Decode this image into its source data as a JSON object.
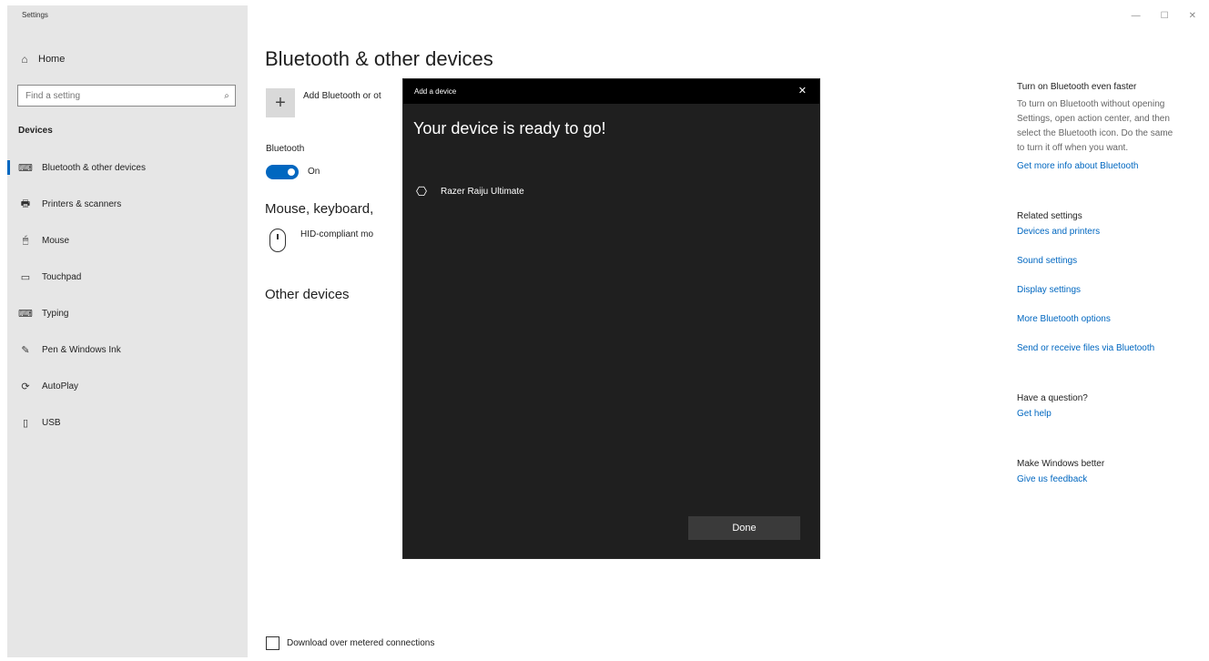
{
  "app": {
    "title": "Settings"
  },
  "window_controls": {
    "minimize": "—",
    "maximize": "☐",
    "close": "✕"
  },
  "sidebar": {
    "home_label": "Home",
    "search": {
      "placeholder": "Find a setting"
    },
    "section_label": "Devices",
    "items": [
      {
        "label": "Bluetooth & other devices",
        "icon": "bluetooth-device-icon",
        "glyph": "⌨"
      },
      {
        "label": "Printers & scanners",
        "icon": "printer-icon",
        "glyph": "🖶"
      },
      {
        "label": "Mouse",
        "icon": "mouse-icon",
        "glyph": "🖱"
      },
      {
        "label": "Touchpad",
        "icon": "touchpad-icon",
        "glyph": "▭"
      },
      {
        "label": "Typing",
        "icon": "keyboard-icon",
        "glyph": "⌨"
      },
      {
        "label": "Pen & Windows Ink",
        "icon": "pen-icon",
        "glyph": "✎"
      },
      {
        "label": "AutoPlay",
        "icon": "autoplay-icon",
        "glyph": "⟳"
      },
      {
        "label": "USB",
        "icon": "usb-icon",
        "glyph": "▯"
      }
    ]
  },
  "main": {
    "title": "Bluetooth & other devices",
    "add_device_text": "Add Bluetooth or ot",
    "bluetooth_label": "Bluetooth",
    "bluetooth_state": "On",
    "mouse_heading": "Mouse, keyboard,",
    "hid_text": "HID-compliant mo",
    "other_heading": "Other devices",
    "metered_label": "Download over metered connections"
  },
  "right_panel": {
    "turn_on_heading": "Turn on Bluetooth even faster",
    "turn_on_body": "To turn on Bluetooth without opening Settings, open action center, and then select the Bluetooth icon. Do the same to turn it off when you want.",
    "learn_more_link": "Get more info about Bluetooth",
    "related_heading": "Related settings",
    "related_links": [
      "Devices and printers",
      "Sound settings",
      "Display settings",
      "More Bluetooth options",
      "Send or receive files via Bluetooth"
    ],
    "question_heading": "Have a question?",
    "help_link": "Get help",
    "better_heading": "Make Windows better",
    "feedback_link": "Give us feedback"
  },
  "dialog": {
    "title": "Add a device",
    "heading": "Your device is ready to go!",
    "device_name": "Razer Raiju Ultimate",
    "done_label": "Done"
  },
  "colors": {
    "accent": "#0067c0",
    "dialog_bg": "#1f1f1f",
    "sidebar_bg": "#e6e6e6"
  }
}
